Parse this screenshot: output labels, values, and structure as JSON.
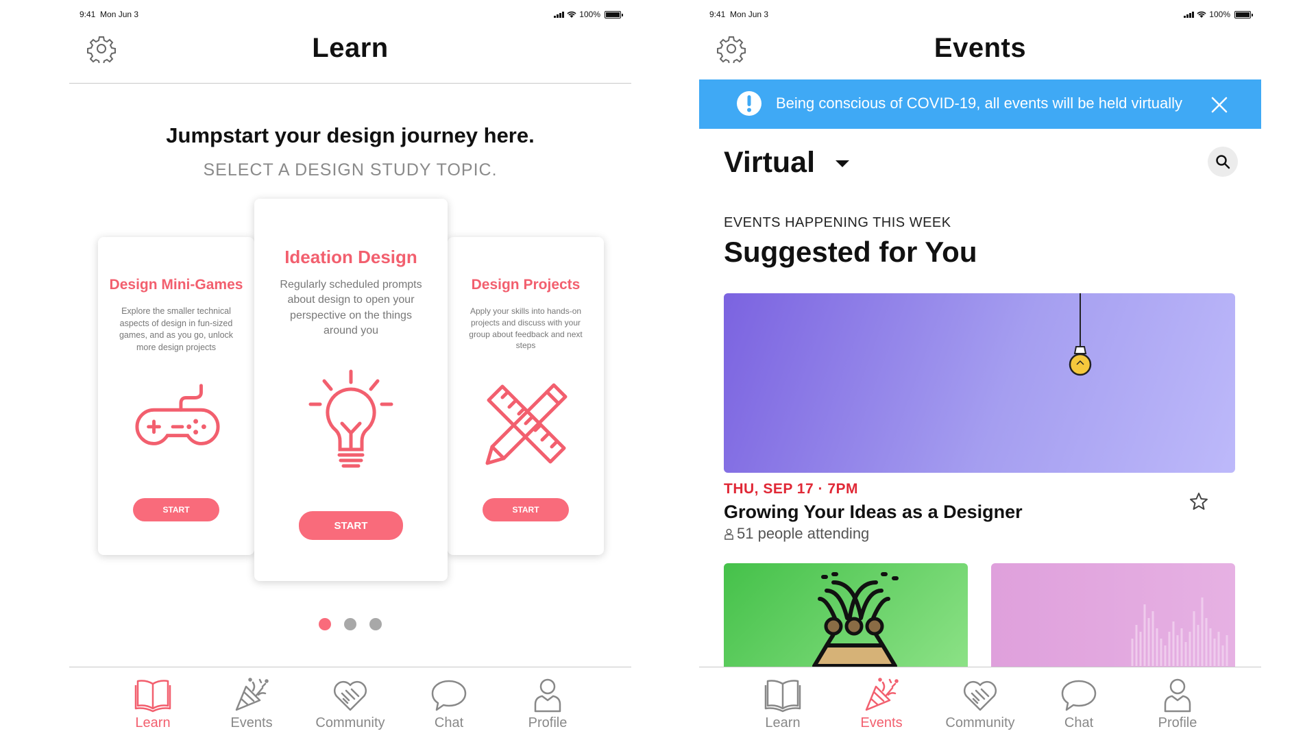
{
  "status_bar": {
    "time": "9:41",
    "date": "Mon Jun 3",
    "battery": "100%"
  },
  "learn": {
    "title": "Learn",
    "tagline": "Jumpstart your design journey here.",
    "subtagline": "SELECT A DESIGN STUDY TOPIC.",
    "cards": [
      {
        "title": "Design Mini-Games",
        "description": "Explore the smaller technical aspects of design in fun-sized games, and as you go, unlock more design projects",
        "button": "START",
        "icon": "gamepad-icon"
      },
      {
        "title": "Ideation Design",
        "description": "Regularly scheduled prompts about design to open your perspective on the things around you",
        "button": "START",
        "icon": "lightbulb-icon"
      },
      {
        "title": "Design Projects",
        "description": "Apply your skills into hands-on projects and discuss with your group about feedback and next steps",
        "button": "START",
        "icon": "pencil-ruler-icon"
      }
    ],
    "carousel": {
      "total": 3,
      "active_index": 0
    }
  },
  "events": {
    "title": "Events",
    "banner_text": "Being conscious of COVID-19, all events will be held virtually",
    "filter": "Virtual",
    "section_kicker": "EVENTS HAPPENING THIS WEEK",
    "section_title": "Suggested for You",
    "featured_event": {
      "date": "THU, SEP 17 · 7PM",
      "title": "Growing Your Ideas as a Designer",
      "attending": "51 people attending"
    }
  },
  "tabs": [
    {
      "label": "Learn",
      "icon": "book-icon"
    },
    {
      "label": "Events",
      "icon": "party-popper-icon"
    },
    {
      "label": "Community",
      "icon": "handshake-heart-icon"
    },
    {
      "label": "Chat",
      "icon": "chat-bubble-icon"
    },
    {
      "label": "Profile",
      "icon": "person-icon"
    }
  ],
  "colors": {
    "accent": "#f25f6e",
    "button": "#f96b7b",
    "banner": "#3fa9f5",
    "date": "#e02836"
  }
}
